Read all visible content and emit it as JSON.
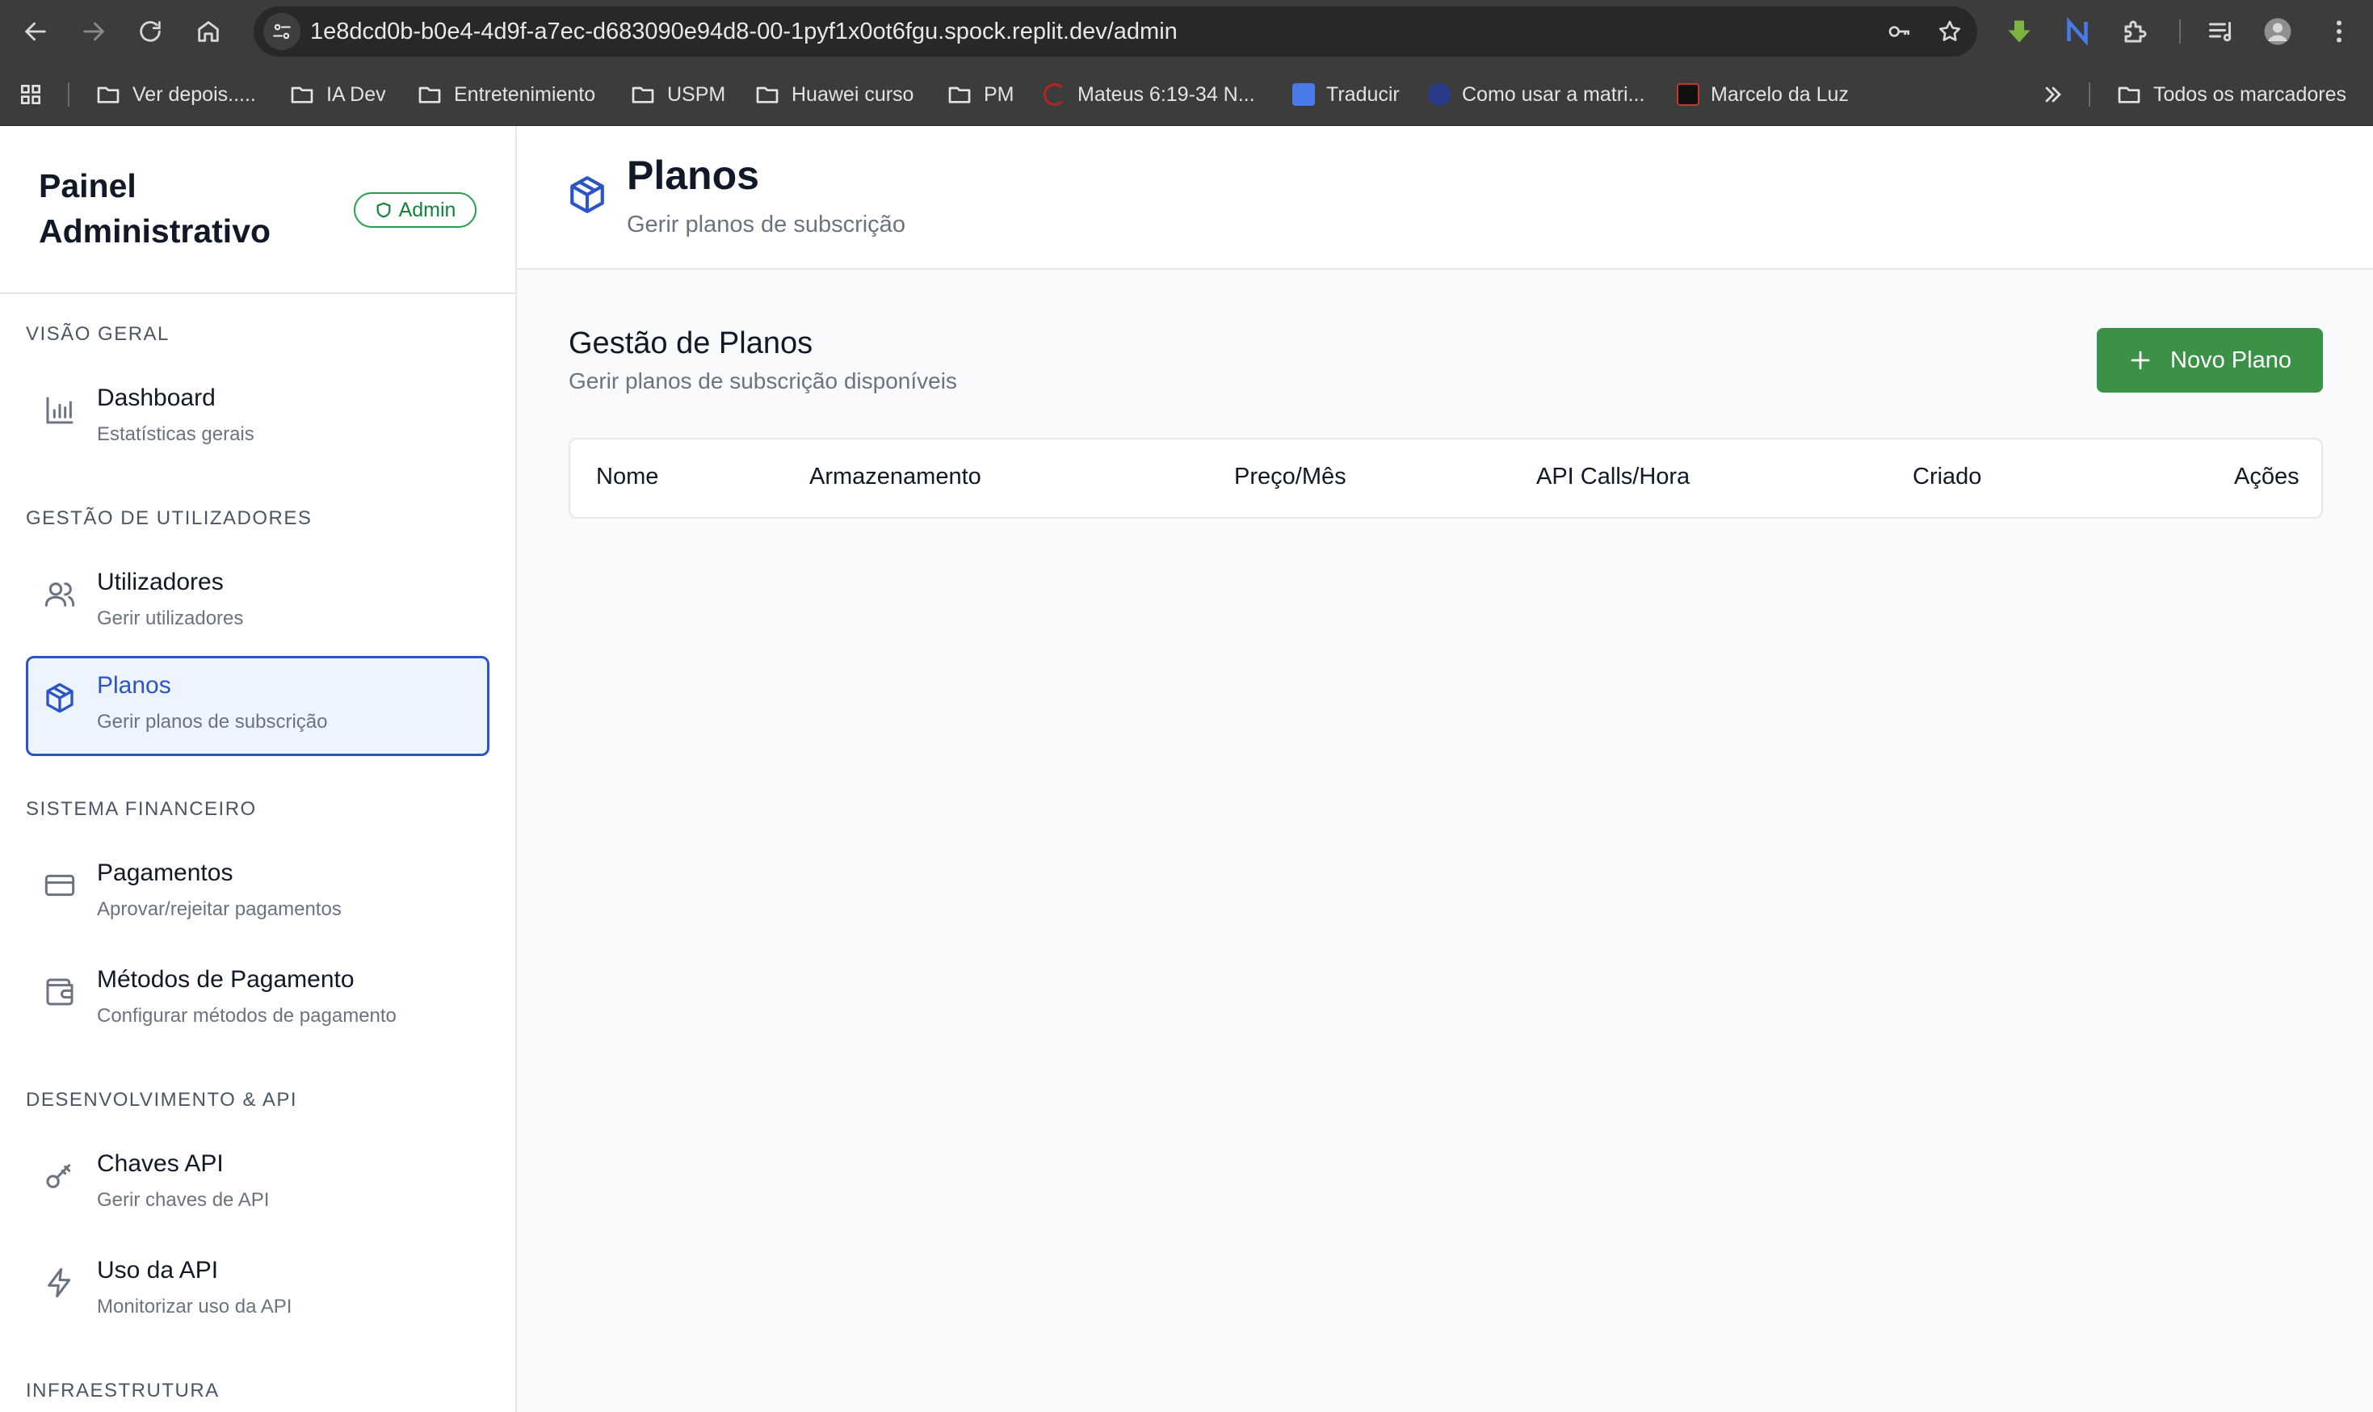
{
  "browser": {
    "url": "1e8dcd0b-b0e4-4d9f-a7ec-d683090e94d8-00-1pyf1x0ot6fgu.spock.replit.dev/admin",
    "bookmarks": [
      {
        "label": "Ver depois.....",
        "icon": "folder-icon"
      },
      {
        "label": "IA Dev",
        "icon": "folder-icon"
      },
      {
        "label": "Entretenimiento",
        "icon": "folder-icon"
      },
      {
        "label": "USPM",
        "icon": "folder-icon"
      },
      {
        "label": "Huawei curso",
        "icon": "folder-icon"
      },
      {
        "label": "PM",
        "icon": "folder-icon"
      },
      {
        "label": "Mateus 6:19-34 N...",
        "icon": "site-favicon"
      },
      {
        "label": "Traducir",
        "icon": "translate-favicon"
      },
      {
        "label": "Como usar a matri...",
        "icon": "site-favicon"
      },
      {
        "label": "Marcelo da Luz",
        "icon": "site-favicon"
      }
    ],
    "all_bookmarks": "Todos os marcadores"
  },
  "sidebar": {
    "title": "Painel Administrativo",
    "badge": "Admin",
    "sections": [
      {
        "label": "VISÃO GERAL",
        "items": [
          {
            "label": "Dashboard",
            "sub": "Estatísticas gerais",
            "icon": "bar-chart-icon"
          }
        ]
      },
      {
        "label": "GESTÃO DE UTILIZADORES",
        "items": [
          {
            "label": "Utilizadores",
            "sub": "Gerir utilizadores",
            "icon": "users-icon"
          },
          {
            "label": "Planos",
            "sub": "Gerir planos de subscrição",
            "icon": "package-icon",
            "active": true
          }
        ]
      },
      {
        "label": "SISTEMA FINANCEIRO",
        "items": [
          {
            "label": "Pagamentos",
            "sub": "Aprovar/rejeitar pagamentos",
            "icon": "credit-card-icon"
          },
          {
            "label": "Métodos de Pagamento",
            "sub": "Configurar métodos de pagamento",
            "icon": "wallet-icon"
          }
        ]
      },
      {
        "label": "DESENVOLVIMENTO & API",
        "items": [
          {
            "label": "Chaves API",
            "sub": "Gerir chaves de API",
            "icon": "key-icon"
          },
          {
            "label": "Uso da API",
            "sub": "Monitorizar uso da API",
            "icon": "zap-icon"
          }
        ]
      },
      {
        "label": "INFRAESTRUTURA",
        "items": []
      }
    ]
  },
  "header": {
    "title": "Planos",
    "subtitle": "Gerir planos de subscrição"
  },
  "content": {
    "title": "Gestão de Planos",
    "subtitle": "Gerir planos de subscrição disponíveis",
    "new_button": "Novo Plano",
    "columns": [
      "Nome",
      "Armazenamento",
      "Preço/Mês",
      "API Calls/Hora",
      "Criado",
      "Ações"
    ],
    "rows": []
  },
  "colors": {
    "accent": "#2b55c7",
    "active_bg": "#eef4fd",
    "primary_button": "#3b9145",
    "admin_badge": "#22a04b"
  }
}
